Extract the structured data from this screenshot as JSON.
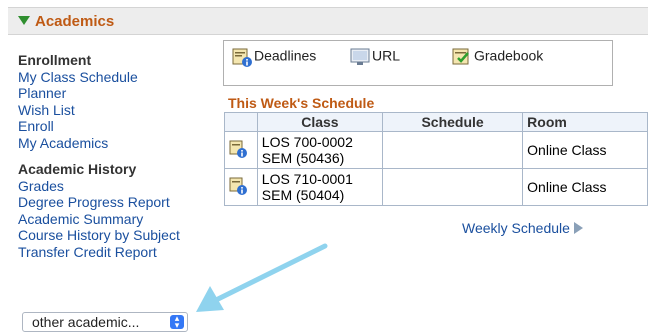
{
  "header": {
    "title": "Academics"
  },
  "sidebar": {
    "sections": [
      {
        "heading": "Enrollment",
        "links": [
          "My Class Schedule",
          "Planner",
          "Wish List",
          "Enroll",
          "My Academics"
        ]
      },
      {
        "heading": "Academic History",
        "links": [
          "Grades",
          "Degree Progress Report",
          "Academic Summary",
          "Course History by Subject",
          "Transfer Credit Report"
        ]
      }
    ],
    "dropdown": {
      "value": "other academic..."
    }
  },
  "quicklinks": {
    "deadlines": "Deadlines",
    "url": "URL",
    "gradebook": "Gradebook"
  },
  "schedule": {
    "title": "This Week's Schedule",
    "columns": [
      "Class",
      "Schedule",
      "Room"
    ],
    "rows": [
      {
        "class_line1": "LOS 700-0002",
        "class_line2": "SEM (50436)",
        "schedule": "",
        "room": "Online Class"
      },
      {
        "class_line1": "LOS 710-0001",
        "class_line2": "SEM (50404)",
        "schedule": "",
        "room": "Online Class"
      }
    ],
    "weekly_link": "Weekly Schedule"
  },
  "colors": {
    "brand_orange": "#bf5a14",
    "link_blue": "#1a4f9e",
    "annotation_arrow": "#8fd3ee"
  }
}
